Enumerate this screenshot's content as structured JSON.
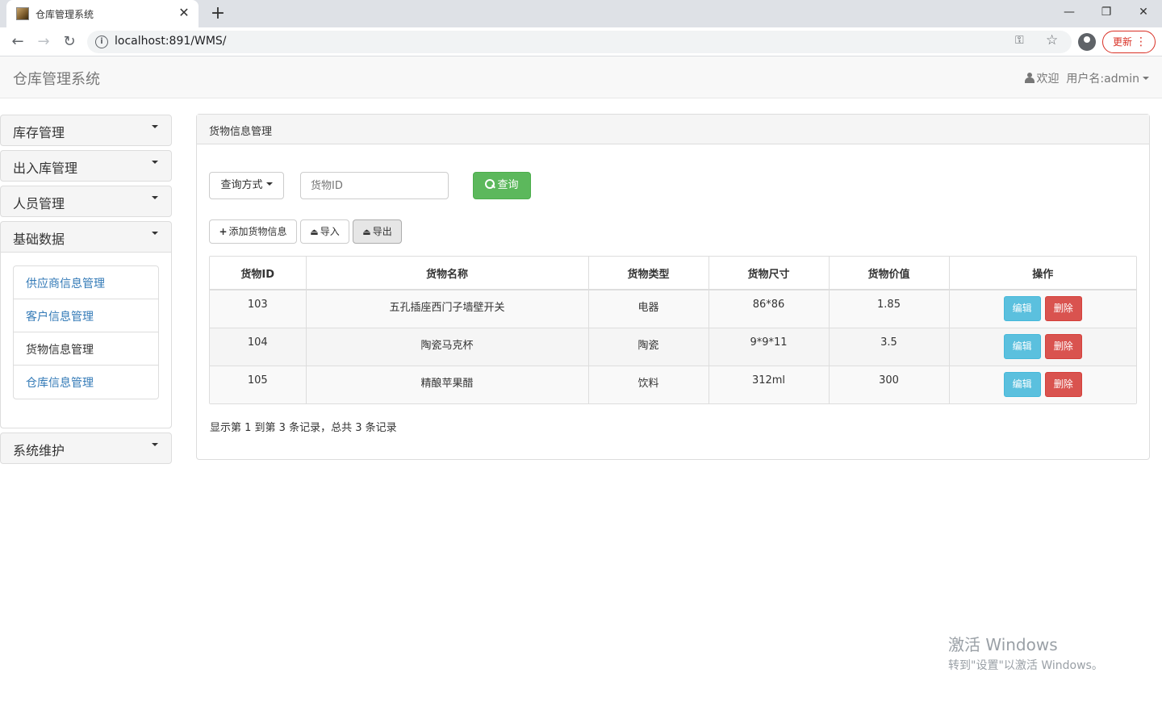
{
  "browser": {
    "tab_title": "仓库管理系统",
    "tab_close": "✕",
    "new_tab": "+",
    "url": "localhost:891/WMS/",
    "update_label": "更新",
    "win_minimize": "—",
    "win_restore": "❐",
    "win_close": "✕"
  },
  "navbar": {
    "brand": "仓库管理系统",
    "welcome": "欢迎",
    "username": "用户名:admin"
  },
  "sidebar": {
    "groups": [
      {
        "label": "库存管理"
      },
      {
        "label": "出入库管理"
      },
      {
        "label": "人员管理"
      },
      {
        "label": "基础数据",
        "items": [
          "供应商信息管理",
          "客户信息管理",
          "货物信息管理",
          "仓库信息管理"
        ]
      },
      {
        "label": "系统维护"
      }
    ]
  },
  "main": {
    "heading": "货物信息管理",
    "query_mode_label": "查询方式",
    "search_placeholder": "货物ID",
    "search_button": "查询",
    "add_button": "添加货物信息",
    "import_button": "导入",
    "export_button": "导出",
    "table": {
      "headers": [
        "货物ID",
        "货物名称",
        "货物类型",
        "货物尺寸",
        "货物价值",
        "操作"
      ],
      "rows": [
        {
          "id": "103",
          "name": "五孔插座西门子墙壁开关",
          "type": "电器",
          "size": "86*86",
          "value": "1.85"
        },
        {
          "id": "104",
          "name": "陶瓷马克杯",
          "type": "陶瓷",
          "size": "9*9*11",
          "value": "3.5"
        },
        {
          "id": "105",
          "name": "精酿苹果醋",
          "type": "饮料",
          "size": "312ml",
          "value": "300"
        }
      ],
      "edit_label": "编辑",
      "delete_label": "删除"
    },
    "pager_info": "显示第 1 到第 3 条记录，总共 3 条记录"
  },
  "watermark": {
    "line1": "激活 Windows",
    "line2": "转到\"设置\"以激活 Windows。"
  },
  "colors": {
    "success": "#5cb85c",
    "info": "#5bc0de",
    "danger": "#d9534f",
    "link": "#337ab7"
  }
}
